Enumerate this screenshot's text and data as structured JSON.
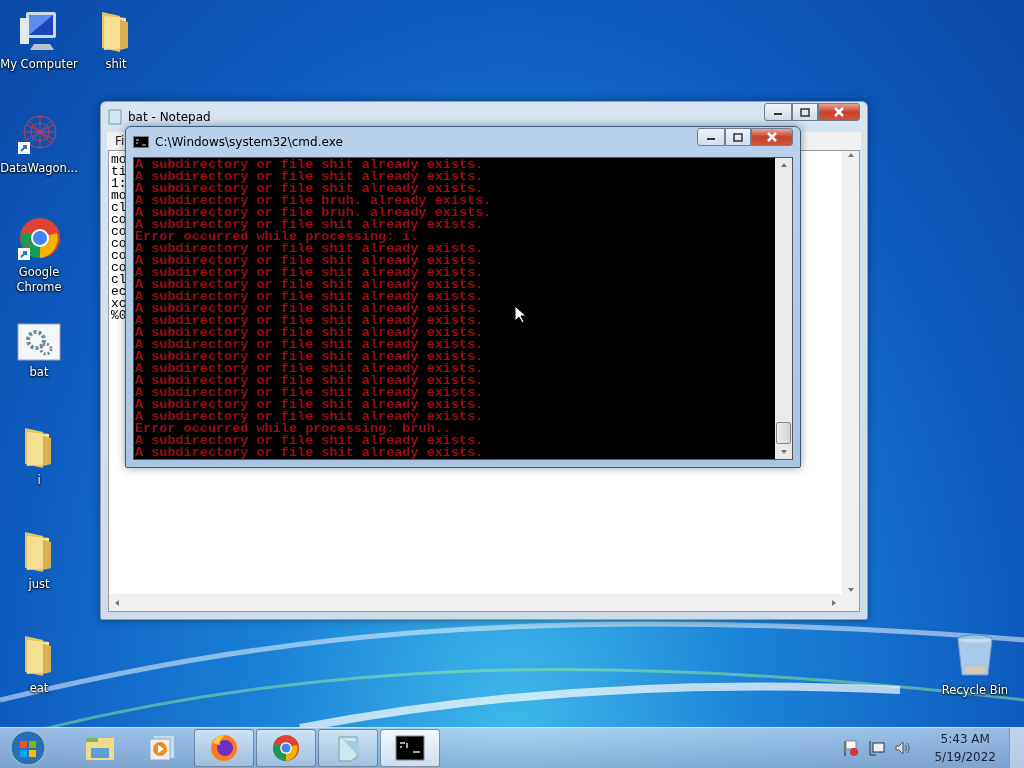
{
  "desktop_icons": [
    {
      "label": "My Computer",
      "kind": "computer"
    },
    {
      "label": "shit",
      "kind": "folder"
    },
    {
      "label": "DataWagon...",
      "kind": "web"
    },
    {
      "label": "Google Chrome",
      "kind": "chrome"
    },
    {
      "label": "bat",
      "kind": "batch"
    },
    {
      "label": "i",
      "kind": "folder"
    },
    {
      "label": "just",
      "kind": "folder"
    },
    {
      "label": "eat",
      "kind": "folder"
    },
    {
      "label": "Recycle Bin",
      "kind": "bin"
    }
  ],
  "notepad": {
    "title": "bat - Notepad",
    "menu": [
      "Fi"
    ],
    "lines": [
      "mo",
      "ti",
      "1:",
      "mo",
      "cl",
      "co",
      "co",
      "co",
      "co",
      "co",
      "cl",
      "ec",
      "xc",
      "%0"
    ]
  },
  "cmd": {
    "title": "C:\\Windows\\system32\\cmd.exe",
    "lines": [
      "A subdirectory or file shit already exists.",
      "A subdirectory or file shit already exists.",
      "A subdirectory or file shit already exists.",
      "A subdirectory or file bruh. already exists.",
      "A subdirectory or file bruh. already exists.",
      "A subdirectory or file shit already exists.",
      "Error occurred while processing: i.",
      "A subdirectory or file shit already exists.",
      "A subdirectory or file shit already exists.",
      "A subdirectory or file shit already exists.",
      "A subdirectory or file shit already exists.",
      "A subdirectory or file shit already exists.",
      "A subdirectory or file shit already exists.",
      "A subdirectory or file shit already exists.",
      "A subdirectory or file shit already exists.",
      "A subdirectory or file shit already exists.",
      "A subdirectory or file shit already exists.",
      "A subdirectory or file shit already exists.",
      "A subdirectory or file shit already exists.",
      "A subdirectory or file shit already exists.",
      "A subdirectory or file shit already exists.",
      "A subdirectory or file shit already exists.",
      "Error occurred while processing: bruh..",
      "A subdirectory or file shit already exists.",
      "A subdirectory or file shit already exists."
    ]
  },
  "taskbar": {
    "items": [
      {
        "kind": "explorer",
        "running": false,
        "selected": false
      },
      {
        "kind": "media",
        "running": false,
        "selected": false
      },
      {
        "kind": "firefox",
        "running": true,
        "selected": false
      },
      {
        "kind": "chrome",
        "running": true,
        "selected": false
      },
      {
        "kind": "notepad",
        "running": true,
        "selected": false
      },
      {
        "kind": "cmd",
        "running": true,
        "selected": true
      }
    ],
    "time": "5:43 AM",
    "date": "5/19/2022"
  }
}
